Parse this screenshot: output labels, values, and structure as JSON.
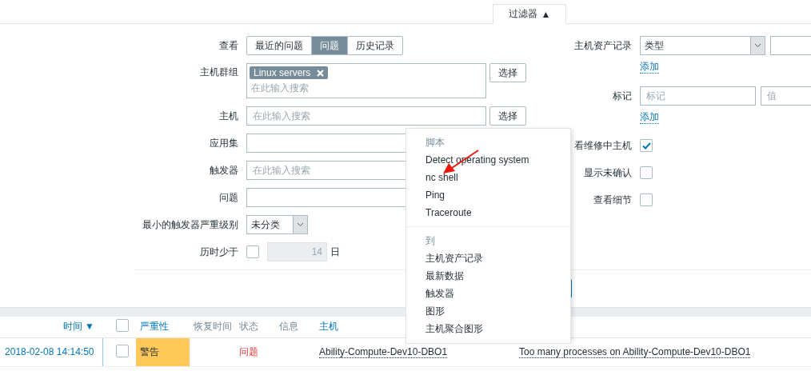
{
  "filter_tab": {
    "label": "过滤器",
    "arrow": "▲",
    "expanded": true
  },
  "filter": {
    "left": [
      {
        "kind": "segmented",
        "label": "查看",
        "options": [
          {
            "label": "最近的问题",
            "selected": false
          },
          {
            "label": "问题",
            "selected": true
          },
          {
            "label": "历史记录",
            "selected": false
          }
        ]
      },
      {
        "kind": "multiselect",
        "label": "主机群组",
        "tags": [
          "Linux servers"
        ],
        "placeholder": "在此输入搜索",
        "button": "选择"
      },
      {
        "kind": "search",
        "label": "主机",
        "placeholder": "在此输入搜索",
        "button": "选择"
      },
      {
        "kind": "text",
        "label": "应用集"
      },
      {
        "kind": "search",
        "label": "触发器",
        "placeholder": "在此输入搜索"
      },
      {
        "kind": "text",
        "label": "问题"
      },
      {
        "kind": "select",
        "label": "最小的触发器严重级别",
        "value": "未分类"
      },
      {
        "kind": "age",
        "label": "历时少于",
        "checked": false,
        "value": "14",
        "disabled": true,
        "unit": "日"
      }
    ],
    "right": [
      {
        "kind": "inventory",
        "label": "主机资产记录",
        "value": "类型",
        "link": "添加"
      },
      {
        "kind": "tags",
        "label": "标记",
        "placeholder": "标记",
        "value_placeholder": "值",
        "link": "添加"
      },
      {
        "kind": "checkbox",
        "label": "看维修中主机",
        "checked": true
      },
      {
        "kind": "checkbox",
        "label": "显示未确认",
        "checked": false
      },
      {
        "kind": "checkbox",
        "label": "查看细节",
        "checked": false
      }
    ]
  },
  "context_menu": {
    "sections": [
      {
        "header": "脚本",
        "items": [
          "Detect operating system",
          "nc shell",
          "Ping",
          "Traceroute"
        ]
      },
      {
        "header": "到",
        "items": [
          "主机资产记录",
          "最新数据",
          "触发器",
          "图形",
          "主机聚合图形"
        ]
      }
    ]
  },
  "table": {
    "columns": [
      {
        "label": "时间",
        "sortable": true,
        "sort": "▼"
      },
      {
        "kind": "checkbox",
        "checked": false
      },
      {
        "label": "严重性",
        "sortable": true
      },
      {
        "label": "恢复时间",
        "sortable": false
      },
      {
        "label": "状态",
        "sortable": false
      },
      {
        "label": "信息",
        "sortable": false
      },
      {
        "label": "主机",
        "sortable": true
      }
    ],
    "rows": [
      {
        "time": "2018-02-08 14:14:50",
        "checked": false,
        "severity": "警告",
        "color": "#ffc859",
        "status": "问题",
        "host": "Ability-Compute-Dev10-DBO1",
        "problem": "Too many processes on Ability-Compute-Dev10-DBO1"
      }
    ]
  }
}
